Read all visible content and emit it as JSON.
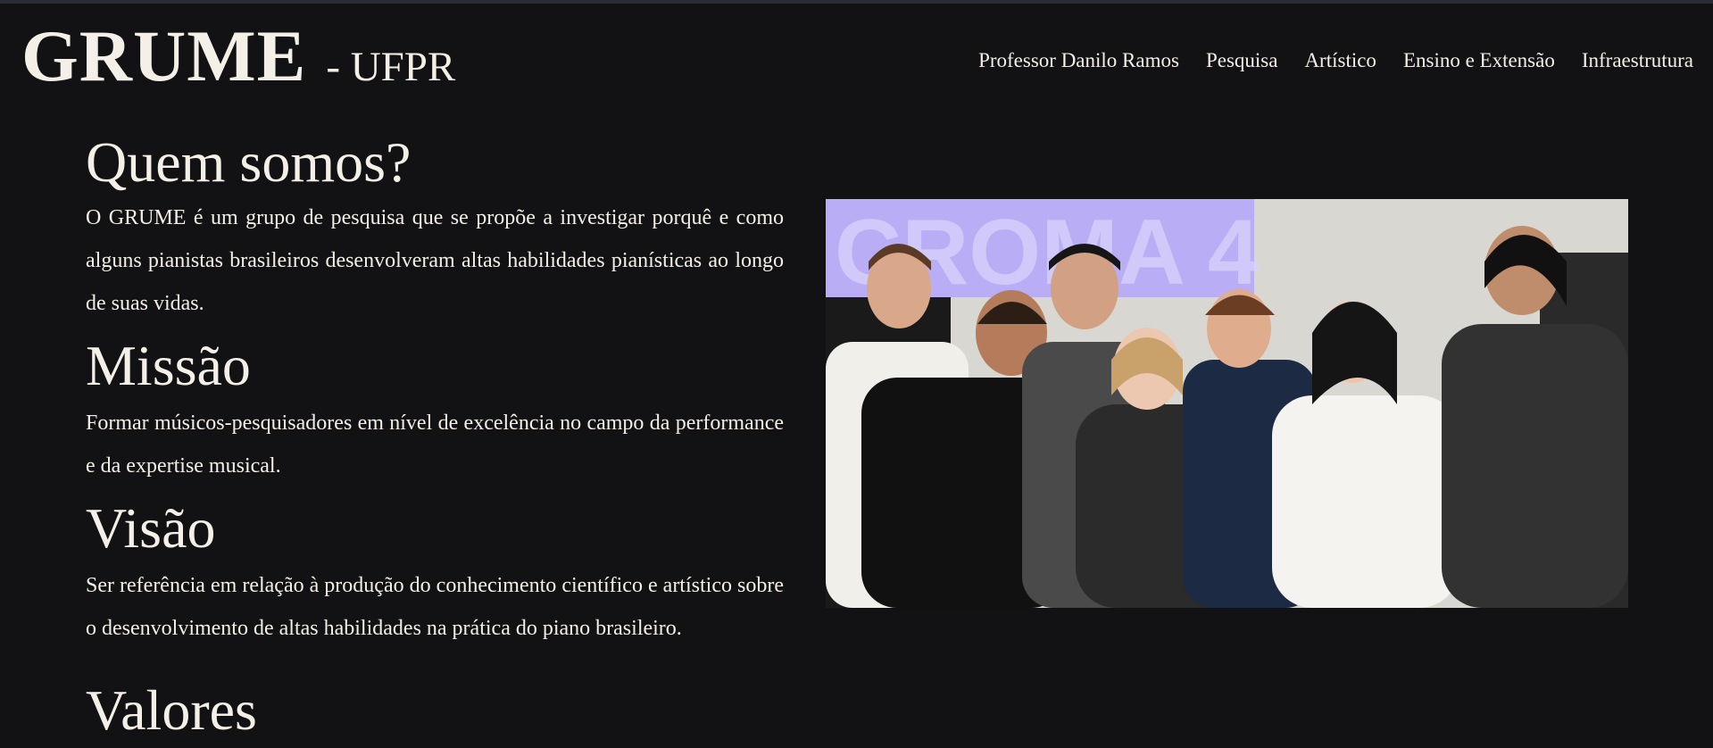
{
  "header": {
    "logo_main": "GRUME",
    "logo_sub": "- UFPR"
  },
  "nav": {
    "items": [
      {
        "label": "Professor Danilo Ramos"
      },
      {
        "label": "Pesquisa"
      },
      {
        "label": "Artístico"
      },
      {
        "label": "Ensino e Extensão"
      },
      {
        "label": "Infraestrutura"
      }
    ]
  },
  "sections": {
    "who": {
      "title": "Quem somos?",
      "text": "O GRUME é um grupo de pesquisa que se propõe a investigar porquê e como alguns pianistas brasileiros desenvolveram altas habilidades pianísticas ao longo de suas vidas."
    },
    "mission": {
      "title": "Missão",
      "text": "Formar músicos-pesquisadores em nível de excelência no campo da performance e da expertise musical."
    },
    "vision": {
      "title": "Visão",
      "text": "Ser referência em relação à produção do conhecimento científico e artístico sobre o desenvolvimento de altas habilidades na prática do piano brasileiro."
    },
    "values": {
      "title": "Valores"
    }
  },
  "photo": {
    "banner_text": "CROMA 4",
    "colors": {
      "background": "#121214",
      "text": "#f4f0e8",
      "banner": "#b9aef5",
      "banner_text": "#d9d3fb"
    }
  }
}
